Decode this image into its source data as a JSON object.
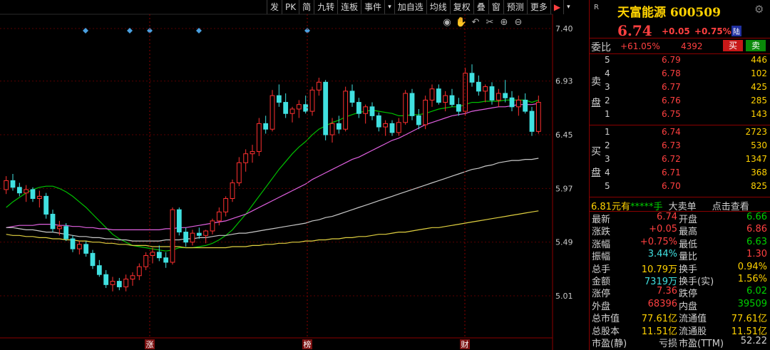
{
  "toolbar": {
    "items": [
      {
        "label": "发",
        "style": "white"
      },
      {
        "label": "PK",
        "style": "white"
      },
      {
        "label": "简",
        "style": "white"
      },
      {
        "label": "九转",
        "style": "white"
      },
      {
        "label": "连板",
        "style": "white"
      },
      {
        "label": "事件",
        "style": "white"
      },
      {
        "label": "▾",
        "style": "arrow"
      },
      {
        "label": "加自选",
        "style": "white"
      },
      {
        "label": "均线",
        "style": "white"
      },
      {
        "label": "复权",
        "style": "white"
      },
      {
        "label": "叠",
        "style": "white"
      },
      {
        "label": "窗",
        "style": "white"
      },
      {
        "label": "预测",
        "style": "white"
      },
      {
        "label": "更多",
        "style": "white"
      },
      {
        "label": "▶",
        "style": "red"
      },
      {
        "label": "▾",
        "style": "arrow"
      }
    ]
  },
  "chart_tools": [
    "eye-icon",
    "hand-icon",
    "undo-icon",
    "scissors-icon",
    "plus-circle-icon",
    "minus-circle-icon"
  ],
  "chart_data": {
    "type": "candlestick",
    "y_axis": {
      "ticks": [
        "7.40",
        "6.93",
        "6.45",
        "5.97",
        "5.49",
        "5.01"
      ]
    },
    "event_markers": [
      {
        "label": "涨",
        "position": "left"
      },
      {
        "label": "榜",
        "position": "middle"
      },
      {
        "label": "财",
        "position": "right"
      }
    ],
    "colors": {
      "up": "#ff3030",
      "down": "#40e0e0",
      "ma_green": "#00c000",
      "ma_magenta": "#e060e0",
      "ma_white": "#c8c8c8",
      "ma_yellow": "#e0d040",
      "grid": "#5a0000",
      "axis": "#8b0000"
    },
    "ohlc": [
      [
        5.96,
        6.08,
        5.92,
        6.04
      ],
      [
        6.04,
        6.1,
        5.95,
        5.98
      ],
      [
        5.98,
        6.02,
        5.9,
        5.93
      ],
      [
        5.93,
        6.0,
        5.85,
        5.96
      ],
      [
        5.96,
        5.98,
        5.85,
        5.88
      ],
      [
        5.88,
        5.95,
        5.8,
        5.9
      ],
      [
        5.9,
        5.93,
        5.7,
        5.74
      ],
      [
        5.74,
        5.78,
        5.58,
        5.61
      ],
      [
        5.61,
        5.68,
        5.55,
        5.63
      ],
      [
        5.63,
        5.66,
        5.5,
        5.52
      ],
      [
        5.52,
        5.55,
        5.4,
        5.43
      ],
      [
        5.43,
        5.5,
        5.38,
        5.47
      ],
      [
        5.47,
        5.5,
        5.36,
        5.39
      ],
      [
        5.39,
        5.42,
        5.25,
        5.28
      ],
      [
        5.28,
        5.33,
        5.18,
        5.2
      ],
      [
        5.2,
        5.24,
        5.08,
        5.11
      ],
      [
        5.11,
        5.18,
        5.05,
        5.14
      ],
      [
        5.14,
        5.17,
        5.06,
        5.09
      ],
      [
        5.09,
        5.2,
        5.05,
        5.16
      ],
      [
        5.16,
        5.22,
        5.1,
        5.19
      ],
      [
        5.19,
        5.3,
        5.15,
        5.27
      ],
      [
        5.27,
        5.4,
        5.24,
        5.37
      ],
      [
        5.37,
        5.44,
        5.3,
        5.4
      ],
      [
        5.4,
        5.46,
        5.32,
        5.35
      ],
      [
        5.35,
        5.4,
        5.26,
        5.31
      ],
      [
        5.31,
        5.8,
        5.29,
        5.78
      ],
      [
        5.78,
        5.8,
        5.55,
        5.58
      ],
      [
        5.58,
        5.62,
        5.45,
        5.49
      ],
      [
        5.49,
        5.6,
        5.46,
        5.57
      ],
      [
        5.57,
        5.62,
        5.52,
        5.55
      ],
      [
        5.55,
        5.6,
        5.48,
        5.59
      ],
      [
        5.59,
        5.7,
        5.56,
        5.68
      ],
      [
        5.68,
        5.8,
        5.64,
        5.76
      ],
      [
        5.76,
        5.9,
        5.72,
        5.88
      ],
      [
        5.88,
        6.05,
        5.85,
        6.02
      ],
      [
        6.02,
        6.25,
        5.99,
        6.2
      ],
      [
        6.2,
        6.32,
        6.12,
        6.28
      ],
      [
        6.28,
        6.36,
        6.2,
        6.3
      ],
      [
        6.3,
        6.6,
        6.26,
        6.55
      ],
      [
        6.55,
        6.62,
        6.46,
        6.5
      ],
      [
        6.5,
        6.85,
        6.48,
        6.8
      ],
      [
        6.8,
        6.9,
        6.7,
        6.74
      ],
      [
        6.74,
        6.82,
        6.6,
        6.64
      ],
      [
        6.64,
        6.7,
        6.56,
        6.68
      ],
      [
        6.68,
        6.76,
        6.6,
        6.72
      ],
      [
        6.72,
        6.8,
        6.64,
        6.66
      ],
      [
        6.66,
        6.88,
        6.62,
        6.85
      ],
      [
        6.85,
        6.96,
        6.8,
        6.92
      ],
      [
        6.92,
        6.94,
        6.4,
        6.45
      ],
      [
        6.45,
        6.6,
        6.38,
        6.55
      ],
      [
        6.55,
        6.62,
        6.46,
        6.5
      ],
      [
        6.5,
        6.88,
        6.48,
        6.84
      ],
      [
        6.84,
        6.9,
        6.7,
        6.74
      ],
      [
        6.74,
        6.78,
        6.6,
        6.64
      ],
      [
        6.64,
        6.72,
        6.55,
        6.7
      ],
      [
        6.7,
        6.74,
        6.58,
        6.62
      ],
      [
        6.62,
        6.65,
        6.48,
        6.52
      ],
      [
        6.52,
        6.58,
        6.44,
        6.55
      ],
      [
        6.55,
        6.58,
        6.44,
        6.47
      ],
      [
        6.47,
        6.6,
        6.44,
        6.56
      ],
      [
        6.56,
        6.85,
        6.54,
        6.82
      ],
      [
        6.82,
        6.86,
        6.58,
        6.62
      ],
      [
        6.62,
        6.68,
        6.5,
        6.54
      ],
      [
        6.54,
        6.8,
        6.5,
        6.76
      ],
      [
        6.76,
        6.9,
        6.7,
        6.86
      ],
      [
        6.86,
        6.9,
        6.72,
        6.74
      ],
      [
        6.74,
        6.84,
        6.66,
        6.8
      ],
      [
        6.8,
        6.86,
        6.7,
        6.72
      ],
      [
        6.72,
        6.78,
        6.62,
        6.66
      ],
      [
        6.66,
        7.05,
        6.62,
        7.0
      ],
      [
        7.0,
        7.08,
        6.88,
        6.92
      ],
      [
        6.92,
        6.98,
        6.8,
        6.84
      ],
      [
        6.84,
        6.9,
        6.74,
        6.88
      ],
      [
        6.88,
        6.92,
        6.72,
        6.76
      ],
      [
        6.76,
        6.86,
        6.7,
        6.82
      ],
      [
        6.82,
        6.94,
        6.74,
        6.78
      ],
      [
        6.78,
        6.84,
        6.66,
        6.7
      ],
      [
        6.7,
        6.8,
        6.62,
        6.76
      ],
      [
        6.76,
        6.82,
        6.64,
        6.66
      ],
      [
        6.66,
        6.7,
        6.44,
        6.48
      ],
      [
        6.48,
        6.8,
        6.46,
        6.74
      ]
    ],
    "ma_lines": [
      {
        "color": "green",
        "values": [
          5.8,
          5.85,
          5.89,
          5.93,
          5.96,
          5.98,
          5.99,
          5.99,
          5.97,
          5.94,
          5.9,
          5.85,
          5.8,
          5.74,
          5.68,
          5.62,
          5.56,
          5.52,
          5.49,
          5.46,
          5.45,
          5.44,
          5.43,
          5.42,
          5.41,
          5.42,
          5.44,
          5.44,
          5.44,
          5.45,
          5.46,
          5.48,
          5.51,
          5.55,
          5.6,
          5.67,
          5.74,
          5.82,
          5.9,
          5.98,
          6.06,
          6.14,
          6.21,
          6.28,
          6.34,
          6.39,
          6.45,
          6.5,
          6.53,
          6.56,
          6.58,
          6.61,
          6.63,
          6.65,
          6.66,
          6.67,
          6.66,
          6.65,
          6.64,
          6.62,
          6.62,
          6.63,
          6.63,
          6.64,
          6.66,
          6.68,
          6.69,
          6.7,
          6.7,
          6.72,
          6.74,
          6.74,
          6.75,
          6.75,
          6.75,
          6.76,
          6.76,
          6.76,
          6.76,
          6.74,
          6.76
        ]
      },
      {
        "color": "magenta",
        "values": [
          5.62,
          5.63,
          5.64,
          5.64,
          5.64,
          5.65,
          5.65,
          5.65,
          5.64,
          5.64,
          5.63,
          5.63,
          5.62,
          5.62,
          5.61,
          5.61,
          5.6,
          5.6,
          5.6,
          5.6,
          5.6,
          5.6,
          5.6,
          5.6,
          5.61,
          5.61,
          5.62,
          5.62,
          5.63,
          5.64,
          5.65,
          5.66,
          5.67,
          5.68,
          5.7,
          5.72,
          5.74,
          5.77,
          5.8,
          5.83,
          5.86,
          5.89,
          5.92,
          5.95,
          5.98,
          6.01,
          6.05,
          6.08,
          6.11,
          6.14,
          6.17,
          6.2,
          6.23,
          6.25,
          6.28,
          6.31,
          6.34,
          6.37,
          6.4,
          6.42,
          6.45,
          6.48,
          6.51,
          6.54,
          6.56,
          6.58,
          6.6,
          6.62,
          6.63,
          6.64,
          6.66,
          6.67,
          6.68,
          6.69,
          6.7,
          6.7,
          6.71,
          6.72,
          6.72,
          6.72,
          6.73
        ]
      },
      {
        "color": "white",
        "values": [
          5.62,
          5.62,
          5.61,
          5.6,
          5.6,
          5.59,
          5.58,
          5.58,
          5.57,
          5.56,
          5.55,
          5.54,
          5.54,
          5.53,
          5.53,
          5.52,
          5.52,
          5.51,
          5.51,
          5.5,
          5.5,
          5.5,
          5.5,
          5.5,
          5.51,
          5.51,
          5.51,
          5.52,
          5.52,
          5.53,
          5.53,
          5.54,
          5.55,
          5.55,
          5.56,
          5.57,
          5.57,
          5.58,
          5.59,
          5.6,
          5.61,
          5.62,
          5.63,
          5.64,
          5.65,
          5.66,
          5.68,
          5.69,
          5.71,
          5.72,
          5.74,
          5.76,
          5.78,
          5.8,
          5.82,
          5.84,
          5.86,
          5.88,
          5.9,
          5.92,
          5.94,
          5.96,
          5.98,
          6.0,
          6.02,
          6.04,
          6.06,
          6.08,
          6.1,
          6.12,
          6.14,
          6.15,
          6.17,
          6.18,
          6.2,
          6.21,
          6.22,
          6.22,
          6.23,
          6.23,
          6.24
        ]
      },
      {
        "color": "yellow",
        "values": [
          5.56,
          5.55,
          5.55,
          5.54,
          5.54,
          5.53,
          5.53,
          5.52,
          5.52,
          5.51,
          5.51,
          5.5,
          5.5,
          5.49,
          5.49,
          5.48,
          5.48,
          5.47,
          5.47,
          5.46,
          5.46,
          5.46,
          5.45,
          5.45,
          5.45,
          5.45,
          5.45,
          5.44,
          5.44,
          5.44,
          5.44,
          5.44,
          5.44,
          5.44,
          5.45,
          5.45,
          5.45,
          5.46,
          5.46,
          5.47,
          5.47,
          5.48,
          5.48,
          5.49,
          5.49,
          5.5,
          5.5,
          5.51,
          5.51,
          5.52,
          5.52,
          5.53,
          5.53,
          5.54,
          5.54,
          5.55,
          5.56,
          5.56,
          5.57,
          5.58,
          5.58,
          5.59,
          5.6,
          5.61,
          5.62,
          5.62,
          5.63,
          5.64,
          5.65,
          5.66,
          5.67,
          5.68,
          5.69,
          5.7,
          5.71,
          5.72,
          5.73,
          5.74,
          5.75,
          5.76,
          5.77
        ]
      }
    ]
  },
  "quote": {
    "code_tag": "R",
    "name": "天富能源",
    "code": "600509",
    "price": "6.74",
    "change": "+0.05",
    "change_pct": "+0.75%",
    "market_tag": "陆",
    "weibi_label": "委比",
    "weibi_pct": "+61.05%",
    "weibi_num": "4392",
    "buy_btn": "买",
    "sell_btn": "卖",
    "sell_side_label": "卖盘",
    "buy_side_label": "买盘",
    "asks": [
      {
        "level": "5",
        "price": "6.79",
        "vol": "446"
      },
      {
        "level": "4",
        "price": "6.78",
        "vol": "102"
      },
      {
        "level": "3",
        "price": "6.77",
        "vol": "425"
      },
      {
        "level": "2",
        "price": "6.76",
        "vol": "285"
      },
      {
        "level": "1",
        "price": "6.75",
        "vol": "143"
      }
    ],
    "bids": [
      {
        "level": "1",
        "price": "6.74",
        "vol": "2723"
      },
      {
        "level": "2",
        "price": "6.73",
        "vol": "530"
      },
      {
        "level": "3",
        "price": "6.72",
        "vol": "1347"
      },
      {
        "level": "4",
        "price": "6.71",
        "vol": "368"
      },
      {
        "level": "5",
        "price": "6.70",
        "vol": "825"
      }
    ],
    "deal_price": "6.81元有",
    "deal_stars": "*****手",
    "deal_big": "大卖单",
    "deal_link": "点击查看",
    "stats": [
      {
        "l1": "最新",
        "v1": "6.74",
        "c1": "red",
        "l2": "开盘",
        "v2": "6.66",
        "c2": "green"
      },
      {
        "l1": "涨跌",
        "v1": "+0.05",
        "c1": "red",
        "l2": "最高",
        "v2": "6.86",
        "c2": "red"
      },
      {
        "l1": "涨幅",
        "v1": "+0.75%",
        "c1": "red",
        "l2": "最低",
        "v2": "6.63",
        "c2": "green"
      },
      {
        "l1": "振幅",
        "v1": "3.44%",
        "c1": "cyan",
        "l2": "量比",
        "v2": "1.30",
        "c2": "red"
      },
      {
        "l1": "总手",
        "v1": "10.79万",
        "c1": "yellow",
        "l2": "换手",
        "v2": "0.94%",
        "c2": "yellow"
      },
      {
        "l1": "金额",
        "v1": "7319万",
        "c1": "cyan",
        "l2": "换手(实)",
        "v2": "1.56%",
        "c2": "yellow"
      },
      {
        "l1": "涨停",
        "v1": "7.36",
        "c1": "red",
        "l2": "跌停",
        "v2": "6.02",
        "c2": "green"
      },
      {
        "l1": "外盘",
        "v1": "68396",
        "c1": "red",
        "l2": "内盘",
        "v2": "39509",
        "c2": "green"
      },
      {
        "l1": "总市值",
        "v1": "77.61亿",
        "c1": "yellow",
        "l2": "流通值",
        "v2": "77.61亿",
        "c2": "yellow"
      },
      {
        "l1": "总股本",
        "v1": "11.51亿",
        "c1": "yellow",
        "l2": "流通股",
        "v2": "11.51亿",
        "c2": "yellow"
      },
      {
        "l1": "市盈(静)",
        "v1": "亏损",
        "c1": "white",
        "l2": "市盈(TTM)",
        "v2": "52.22",
        "c2": "white"
      }
    ]
  }
}
